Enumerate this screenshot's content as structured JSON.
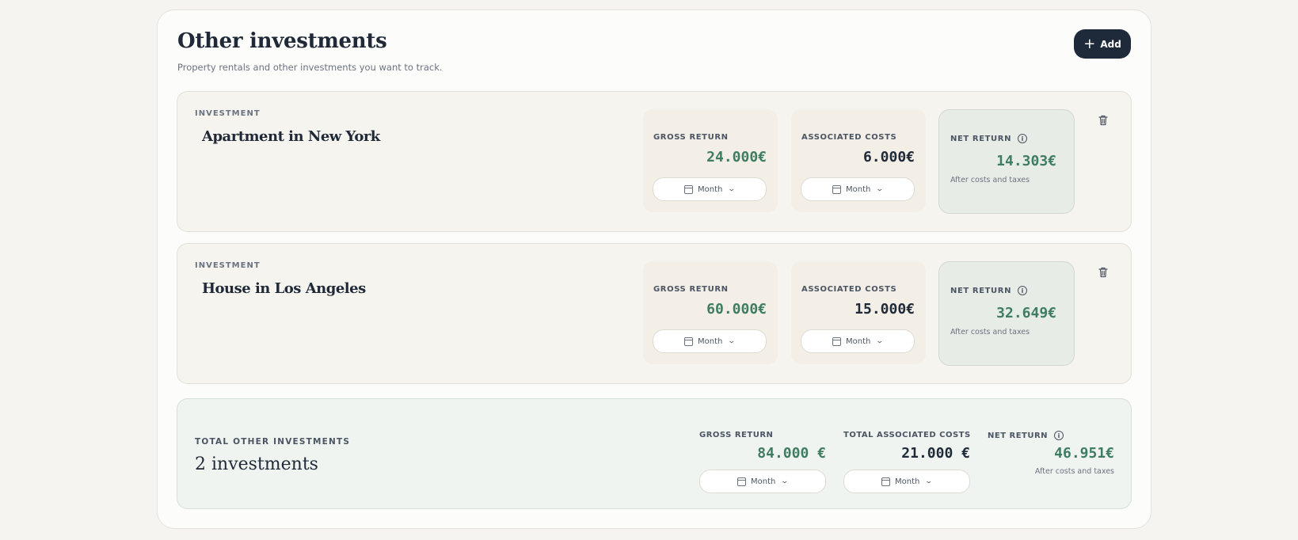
{
  "header": {
    "title": "Other investments",
    "subtitle": "Property rentals and other investments you want to track.",
    "add_label": "Add",
    "add_icon": "plus-icon"
  },
  "investments": [
    {
      "label": "INVESTMENT",
      "name": "Apartment in New York",
      "gross": {
        "label": "GROSS RETURN",
        "value": "24.000€",
        "period": "Month"
      },
      "costs": {
        "label": "ASSOCIATED COSTS",
        "value": "6.000€",
        "period": "Month"
      },
      "net": {
        "label": "NET RETURN",
        "value": "14.303€",
        "note": "After costs and taxes"
      }
    },
    {
      "label": "INVESTMENT",
      "name": "House in Los Angeles",
      "gross": {
        "label": "GROSS RETURN",
        "value": "60.000€",
        "period": "Month"
      },
      "costs": {
        "label": "ASSOCIATED COSTS",
        "value": "15.000€",
        "period": "Month"
      },
      "net": {
        "label": "NET RETURN",
        "value": "32.649€",
        "note": "After costs and taxes"
      }
    }
  ],
  "total": {
    "label": "TOTAL OTHER INVESTMENTS",
    "count": "2 investments",
    "gross": {
      "label": "GROSS RETURN",
      "value": "84.000 €",
      "period": "Month"
    },
    "costs": {
      "label": "TOTAL ASSOCIATED COSTS",
      "value": "21.000 €",
      "period": "Month"
    },
    "net": {
      "label": "NET RETURN",
      "value": "46.951€",
      "note": "After costs and taxes"
    }
  },
  "colors": {
    "accent_green": "#3f7d62",
    "primary_dark": "#1e2a3a"
  }
}
